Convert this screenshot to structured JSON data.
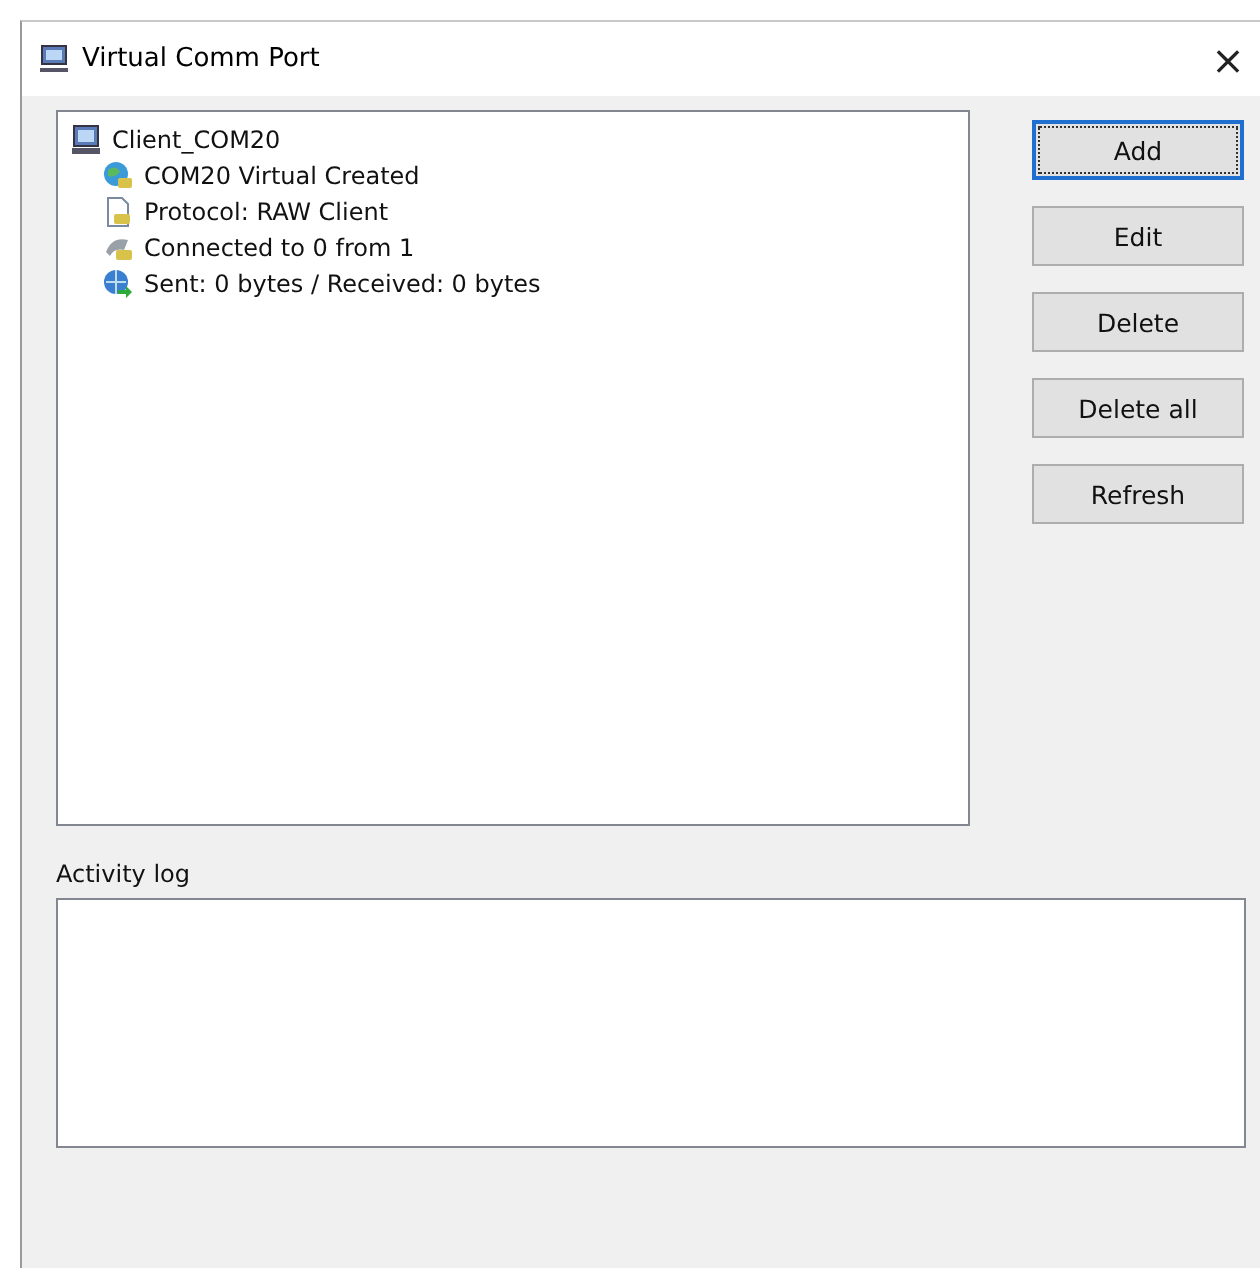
{
  "window": {
    "title": "Virtual Comm Port",
    "close": "×"
  },
  "tree": {
    "root": {
      "label": "Client_COM20",
      "kind": "computer",
      "children": [
        {
          "label": "COM20 Virtual Created",
          "kind": "globe-plug"
        },
        {
          "label": "Protocol: RAW Client",
          "kind": "document"
        },
        {
          "label": "Connected to 0 from 1",
          "kind": "plug"
        },
        {
          "label": "Sent: 0 bytes / Received: 0 bytes",
          "kind": "globe-arrow"
        }
      ]
    }
  },
  "buttons": [
    {
      "label": "Add",
      "focused": true
    },
    {
      "label": "Edit",
      "focused": false
    },
    {
      "label": "Delete",
      "focused": false
    },
    {
      "label": "Delete all",
      "focused": false
    },
    {
      "label": "Refresh",
      "focused": false
    }
  ],
  "activity_log": {
    "label": "Activity log"
  }
}
